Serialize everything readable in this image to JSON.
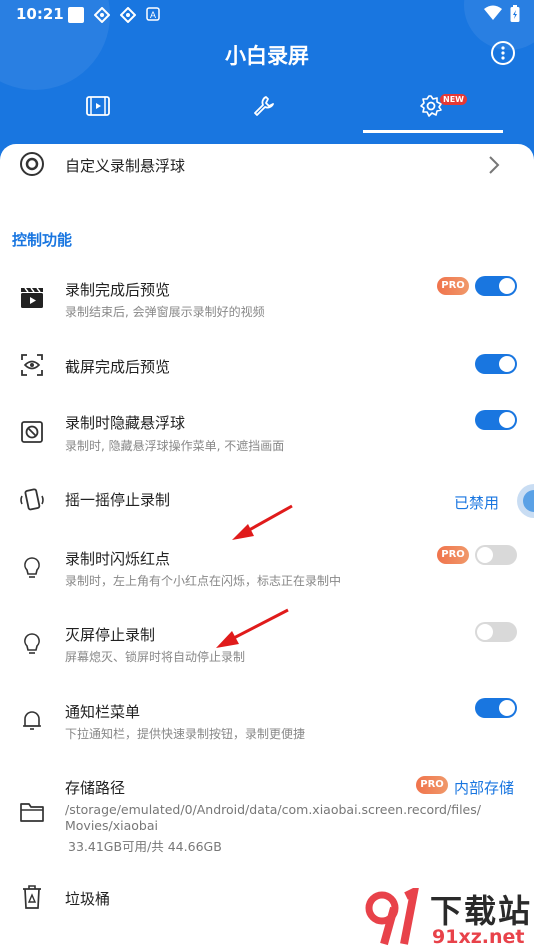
{
  "status_bar": {
    "time": "10:21"
  },
  "header": {
    "title": "小白录屏",
    "tabs": [
      {
        "icon": "video-tab-icon"
      },
      {
        "icon": "wrench-tab-icon"
      },
      {
        "icon": "settings-tab-icon",
        "badge": "NEW",
        "active": true
      }
    ]
  },
  "floating_ball": {
    "label": "自定义录制悬浮球"
  },
  "section": {
    "title": "控制功能"
  },
  "settings": [
    {
      "title": "录制完成后预览",
      "subtitle": "录制结束后, 会弹窗展示录制好的视频",
      "pro": "PRO",
      "toggle": "on"
    },
    {
      "title": "截屏完成后预览",
      "toggle": "on"
    },
    {
      "title": "录制时隐藏悬浮球",
      "subtitle": "录制时, 隐藏悬浮球操作菜单, 不遮挡画面",
      "toggle": "on"
    },
    {
      "title": "摇一摇停止录制",
      "status": "已禁用"
    },
    {
      "title": "录制时闪烁红点",
      "subtitle": "录制时，左上角有个小红点在闪烁，标志正在录制中",
      "pro": "PRO",
      "toggle": "off"
    },
    {
      "title": "灭屏停止录制",
      "subtitle": "屏幕熄灭、锁屏时将自动停止录制",
      "toggle": "off"
    },
    {
      "title": "通知栏菜单",
      "subtitle": "下拉通知栏，提供快速录制按钮，录制更便捷",
      "toggle": "on"
    },
    {
      "title": "存储路径",
      "path_line1": "/storage/emulated/0/Android/data/com.xiaobai.screen.record/files/",
      "path_line2": "Movies/xiaobai",
      "storage": "33.41GB可用/共 44.66GB",
      "pro": "PRO",
      "link": "内部存储"
    },
    {
      "title": "垃圾桶"
    }
  ],
  "watermark": {
    "text": "下载站",
    "domain": "91xz.net"
  },
  "colors": {
    "accent": "#1976e0",
    "pro": "#f0734c",
    "annotation_arrow": "#e01b1b"
  }
}
